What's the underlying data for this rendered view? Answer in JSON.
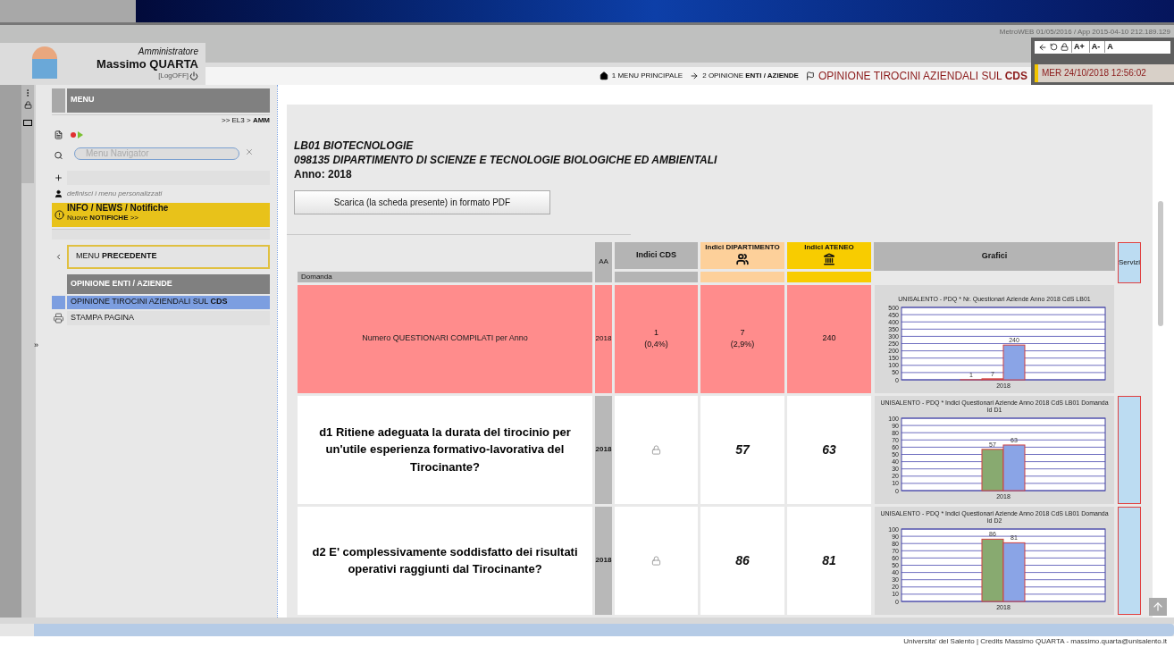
{
  "system_info": "MetroWEB 01/05/2016 / App 2015-04-10  212.189.129",
  "user": {
    "role": "Amministratore",
    "name": "Massimo QUARTA",
    "logoff": "[LogOFF]"
  },
  "toolbar": [
    "A+",
    "A-",
    "A"
  ],
  "breadcrumb": [
    {
      "label": "1 MENU PRINCIPALE"
    },
    {
      "label": "2 OPINIONE **ENTI / AZIENDE**"
    }
  ],
  "current_page": "OPINIONE TIROCINI AZIENDALI SUL **CDS**",
  "datetime": "MER 24/10/2018 12:56:02",
  "sidebar": {
    "title": "MENU",
    "path": ">> EL3 > **AMM**",
    "search": {
      "placeholder": "Menu Navigator"
    },
    "custom_menu": "definisci i menu personalizzati",
    "info": {
      "title": "INFO / NEWS / Notifiche",
      "subtitle": "Nuove **NOTIFICHE**  >>"
    },
    "back": "MENU **PRECEDENTE**",
    "section": "OPINIONE ENTI / AZIENDE",
    "items": [
      {
        "label": "OPINIONE TIROCINI AZIENDALI SUL **CDS**",
        "selected": true
      }
    ],
    "print": "STAMPA PAGINA",
    "expander": "»"
  },
  "content": {
    "heading": [
      "LB01 BIOTECNOLOGIE",
      "098135 DIPARTIMENTO DI SCIENZE E TECNOLOGIE BIOLOGICHE ED AMBIENTALI"
    ],
    "year": "Anno: 2018",
    "pdf_button": "Scarica (la scheda presente) in formato PDF",
    "table": {
      "columns": {
        "question": "Domanda",
        "aa": "AA",
        "cds": "Indici CDS",
        "department": "Indici DIPARTIMENTO",
        "university": "Indici ATENEO",
        "charts": "Grafici",
        "services": "Servizi"
      },
      "rows": [
        {
          "kind": "count",
          "question": "Numero QUESTIONARI COMPILATI per Anno",
          "aa": "2018",
          "cds": "1",
          "cds_share": "(0,4%)",
          "department": "7",
          "department_share": "(2,9%)",
          "university": "240",
          "chart_data": {
            "type": "bar",
            "title": "UNISALENTO - PDQ * Nr. Questionari Aziende Anno 2018 CdS LB01",
            "categories": [
              "2018"
            ],
            "series": [
              {
                "color": "#ffffff",
                "values": [
                  1
                ]
              },
              {
                "color": "#e06060",
                "values": [
                  7
                ]
              },
              {
                "color": "#8aa4e6",
                "values": [
                  240
                ]
              }
            ],
            "ylim": [
              0,
              500
            ],
            "grid": true,
            "yticks": [
              0,
              50,
              100,
              150,
              200,
              250,
              300,
              350,
              400,
              450,
              500
            ],
            "data_labels": true
          }
        },
        {
          "kind": "question",
          "question": "d1 Ritiene adeguata la durata del tirocinio per un'utile esperienza formativo-lavorativa del Tirocinante?",
          "aa": "2018",
          "cds_locked": true,
          "department": "57",
          "university": "63",
          "chart_data": {
            "type": "bar",
            "title": "UNISALENTO - PDQ * Indici Questionari Aziende Anno 2018 CdS LB01 Domanda Id D1",
            "categories": [
              "2018"
            ],
            "series": [
              {
                "color": "#88aa70",
                "values": [
                  57
                ]
              },
              {
                "color": "#8aa4e6",
                "values": [
                  63
                ]
              }
            ],
            "ylim": [
              0,
              100
            ],
            "grid": true,
            "yticks": [
              0,
              10,
              20,
              30,
              40,
              50,
              60,
              70,
              80,
              90,
              100
            ],
            "data_labels": true
          }
        },
        {
          "kind": "question",
          "question": "d2 E' complessivamente soddisfatto dei risultati operativi raggiunti dal Tirocinante?",
          "aa": "2018",
          "cds_locked": true,
          "department": "86",
          "university": "81",
          "chart_data": {
            "type": "bar",
            "title": "UNISALENTO - PDQ * Indici Questionari Aziende Anno 2018 CdS LB01 Domanda Id D2",
            "categories": [
              "2018"
            ],
            "series": [
              {
                "color": "#88aa70",
                "values": [
                  86
                ]
              },
              {
                "color": "#8aa4e6",
                "values": [
                  81
                ]
              }
            ],
            "ylim": [
              0,
              100
            ],
            "grid": true,
            "yticks": [
              0,
              10,
              20,
              30,
              40,
              50,
              60,
              70,
              80,
              90,
              100
            ],
            "data_labels": true
          }
        }
      ]
    }
  },
  "footer": "Universita' del Salento  |  Credits Massimo QUARTA - massimo.quarta@unisalento.it"
}
